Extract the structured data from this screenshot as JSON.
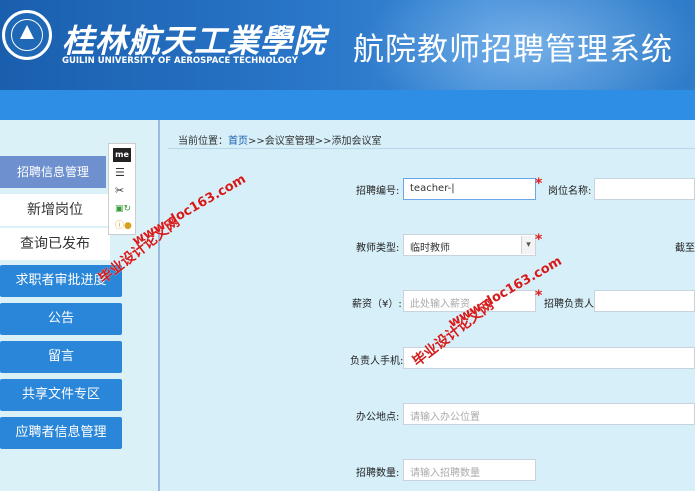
{
  "header": {
    "university_cn": "桂林航天工業學院",
    "university_en": "GUILIN UNIVERSITY OF AEROSPACE TECHNOLOGY",
    "system_title": "航院教师招聘管理系统"
  },
  "sidebar": {
    "items": [
      {
        "label": "招聘信息管理"
      },
      {
        "label": "新增岗位"
      },
      {
        "label": "查询已发布"
      },
      {
        "label": "求职者审批进度"
      },
      {
        "label": "公告"
      },
      {
        "label": "留言"
      },
      {
        "label": "共享文件专区"
      },
      {
        "label": "应聘者信息管理"
      }
    ]
  },
  "toolbar": {
    "me_label": "me"
  },
  "breadcrumb": {
    "prefix": "当前位置：",
    "home": "首页",
    "rest": ">>会议室管理>>添加会议室"
  },
  "form": {
    "job_no_label": "招聘编号:",
    "job_no_value": "teacher-|",
    "post_name_label": "岗位名称:",
    "teacher_type_label": "教师类型:",
    "teacher_type_value": "临时教师",
    "deadline_label": "截至",
    "salary_label": "薪资（¥）:",
    "salary_placeholder": "此处输入薪资",
    "leader_label": "招聘负责人:",
    "phone_label": "负责人手机:",
    "office_label": "办公地点:",
    "office_placeholder": "请输入办公位置",
    "count_label": "招聘数量:",
    "count_placeholder": "请输入招聘数量"
  },
  "watermarks": {
    "text_cn": "毕业设计论文网",
    "text_url": "www.doc163.com"
  },
  "colors": {
    "header": "#2a76c8",
    "band": "#2e8ee6",
    "sidebar_bg": "#daf1f8",
    "sidebar_button": "#2a86d8",
    "required": "#e02020"
  }
}
